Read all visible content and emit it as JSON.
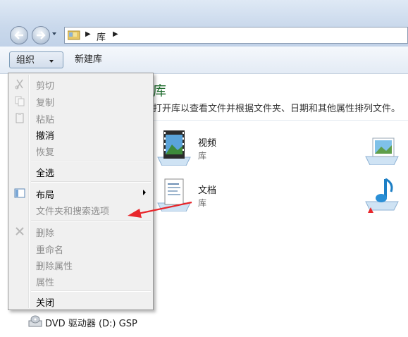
{
  "address_bar": {
    "crumbs": [
      "库"
    ]
  },
  "toolbar": {
    "organize_label": "组织",
    "new_library_label": "新建库"
  },
  "library_view": {
    "title": "库",
    "description": "打开库以查看文件并根据文件夹、日期和其他属性排列文件。",
    "items": [
      {
        "name": "视频",
        "type": "库",
        "icon": "video-library-icon"
      },
      {
        "name": "文档",
        "type": "库",
        "icon": "documents-library-icon"
      },
      {
        "name": "",
        "type": "",
        "icon": "pictures-library-icon"
      },
      {
        "name": "",
        "type": "",
        "icon": "music-library-icon"
      }
    ]
  },
  "nav_pane": {
    "dvd_drive_label": "DVD 驱动器 (D:) GSP"
  },
  "organize_menu": {
    "items": [
      {
        "label": "剪切",
        "enabled": false,
        "icon": "scissors-icon"
      },
      {
        "label": "复制",
        "enabled": false,
        "icon": "copy-icon"
      },
      {
        "label": "粘贴",
        "enabled": false,
        "icon": "paste-icon"
      },
      {
        "label": "撤消",
        "enabled": true,
        "icon": ""
      },
      {
        "label": "恢复",
        "enabled": false,
        "icon": ""
      },
      {
        "label": "全选",
        "enabled": true,
        "icon": ""
      },
      {
        "label": "布局",
        "enabled": true,
        "icon": "layout-icon",
        "submenu": true
      },
      {
        "label": "文件夹和搜索选项",
        "enabled": false,
        "icon": ""
      },
      {
        "label": "删除",
        "enabled": false,
        "icon": "delete-x-icon"
      },
      {
        "label": "重命名",
        "enabled": false,
        "icon": ""
      },
      {
        "label": "删除属性",
        "enabled": false,
        "icon": ""
      },
      {
        "label": "属性",
        "enabled": false,
        "icon": ""
      },
      {
        "label": "关闭",
        "enabled": true,
        "icon": ""
      }
    ]
  },
  "colors": {
    "title_green": "#1e6b2c",
    "annotation_red": "#e8262b",
    "disabled_text": "#8d8d8d"
  }
}
